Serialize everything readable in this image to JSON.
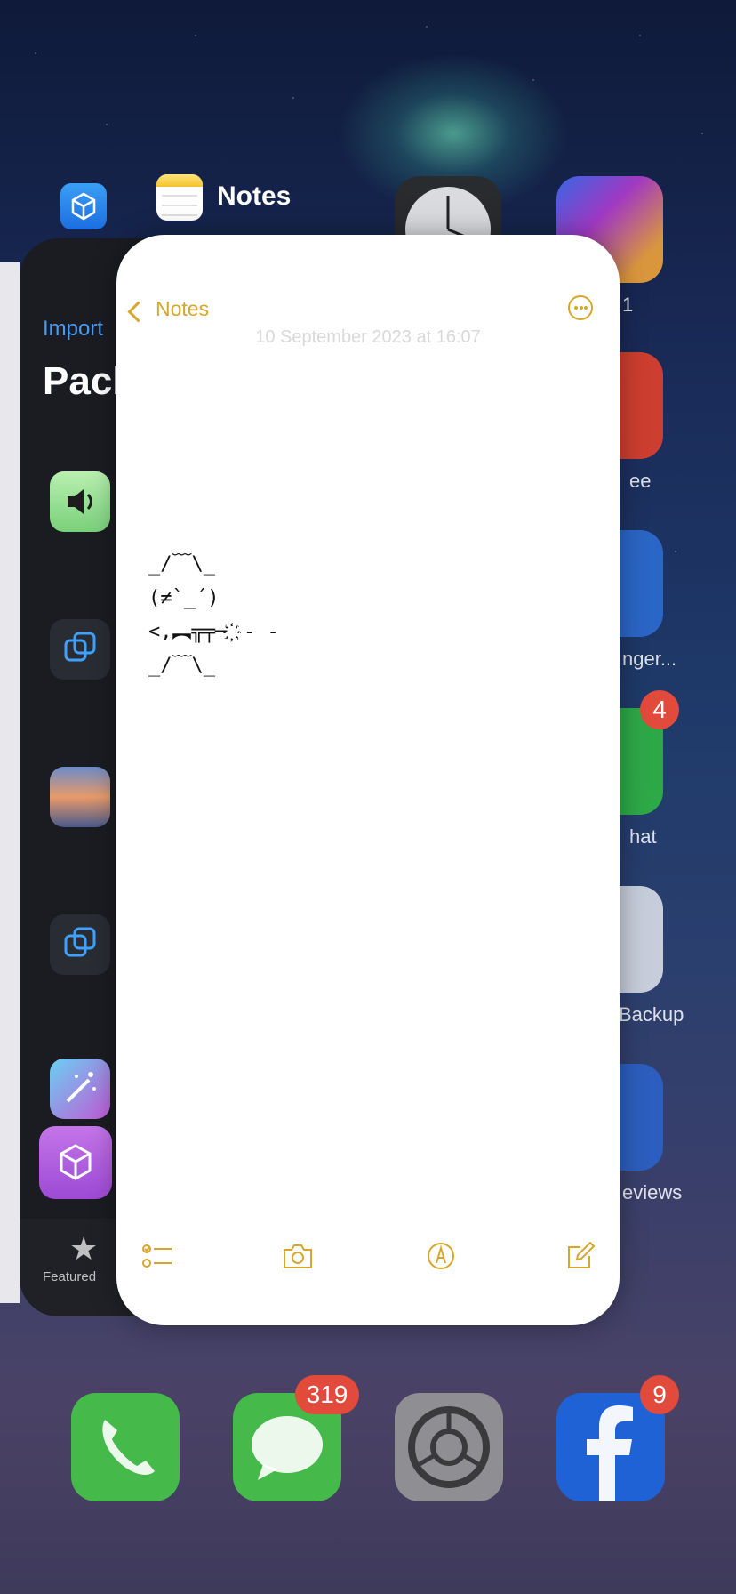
{
  "background": {
    "colors": {
      "accent_notes": "#d6a72c",
      "sileo_blue": "#4a9bf0"
    },
    "home_labels": [
      "1",
      "ee",
      "nger...",
      "hat",
      "Backup",
      "eviews"
    ],
    "badges": {
      "wechat": "4",
      "messages": "319",
      "facebook": "9"
    }
  },
  "switcher": {
    "active_app_title": "Notes",
    "left_card": {
      "import_label": "Import",
      "header_partial": "Pack",
      "tab_featured": "Featured",
      "icons": [
        "speaker-icon",
        "copy-icon",
        "clearity-icon",
        "copy-icon",
        "magic-wand-icon",
        "package-icon"
      ]
    }
  },
  "notes": {
    "back_label": "Notes",
    "date_text": "10 September 2023 at 16:07",
    "ascii_lines": [
      "_/﹋\\_",
      "(≠`_´)",
      "<,︻╦╤─ ҉ - -",
      "_/﹋\\_"
    ],
    "toolbar": [
      "checklist-icon",
      "camera-icon",
      "markup-icon",
      "compose-icon"
    ]
  },
  "dock": {
    "apps": [
      "phone-icon",
      "messages-icon",
      "settings-icon",
      "facebook-icon"
    ]
  }
}
